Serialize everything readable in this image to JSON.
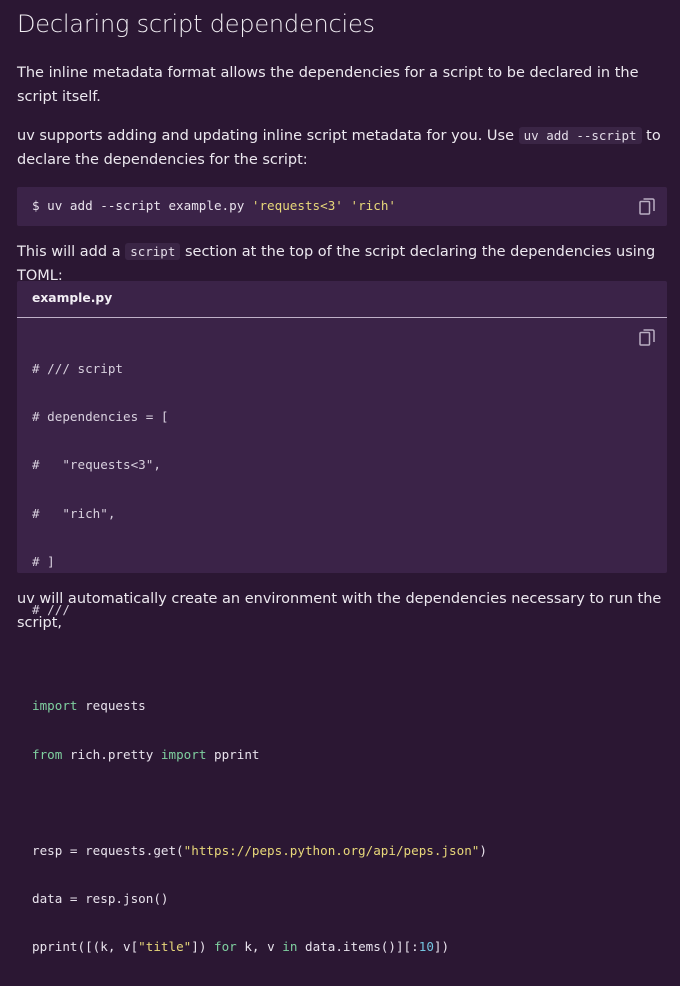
{
  "heading": "Declaring script dependencies",
  "paragraph1": "The inline metadata format allows the dependencies for a script to be declared in the script itself.",
  "paragraph2": {
    "before": "uv supports adding and updating inline script metadata for you. Use ",
    "code": "uv add --script",
    "after": " to declare the dependencies for the script:"
  },
  "command_block": {
    "prefix": "$ uv add --script example.py ",
    "arg1": "'requests<3'",
    "space": " ",
    "arg2": "'rich'",
    "copy_icon": "copy-icon"
  },
  "paragraph3": {
    "before": "This will add a ",
    "code": "script",
    "after": " section at the top of the script declaring the dependencies using TOML:"
  },
  "file_block": {
    "filename": "example.py",
    "copy_icon": "copy-icon",
    "lines": {
      "l1": "# /// script",
      "l2": "# dependencies = [",
      "l3": "#   \"requests<3\",",
      "l4": "#   \"rich\",",
      "l5": "# ]",
      "l6": "# ///",
      "l8_kw": "import",
      "l8_rest": " requests",
      "l9_kw1": "from",
      "l9_mid": " rich.pretty ",
      "l9_kw2": "import",
      "l9_rest": " pprint",
      "l11_a": "resp = requests.get(",
      "l11_str": "\"https://peps.python.org/api/peps.json\"",
      "l11_b": ")",
      "l12": "data = resp.json()",
      "l13_a": "pprint([(k, v[",
      "l13_str": "\"title\"",
      "l13_b": "]) ",
      "l13_kw1": "for",
      "l13_c": " k, v ",
      "l13_kw2": "in",
      "l13_d": " data.items()][:",
      "l13_num": "10",
      "l13_e": "])"
    }
  },
  "paragraph4": "uv will automatically create an environment with the dependencies necessary to run the script,",
  "colors": {
    "background": "#2b1733",
    "code_background": "#3b2348",
    "string": "#e8d87a",
    "keyword": "#7fd0a0",
    "number": "#74c5e0"
  }
}
